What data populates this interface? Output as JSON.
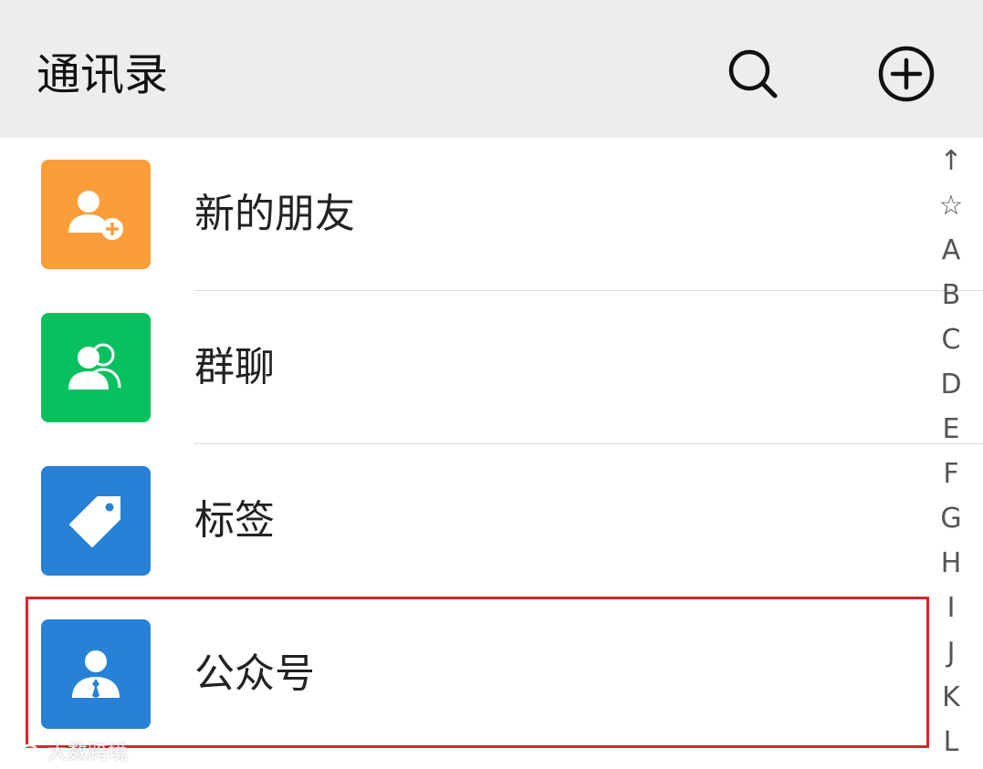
{
  "header": {
    "title": "通讯录",
    "search_icon": "search-icon",
    "add_icon": "plus-circle-icon",
    "background": "#ededed"
  },
  "list": {
    "items": [
      {
        "label": "新的朋友",
        "icon": "add-friend-icon",
        "color": "#fa9d3b"
      },
      {
        "label": "群聊",
        "icon": "group-chat-icon",
        "color": "#07c160"
      },
      {
        "label": "标签",
        "icon": "tag-icon",
        "color": "#2782d7"
      },
      {
        "label": "公众号",
        "icon": "official-account-icon",
        "color": "#2782d7"
      }
    ]
  },
  "highlight": {
    "color": "#d9232b"
  },
  "index_bar": {
    "letters": [
      "↑",
      "☆",
      "A",
      "B",
      "C",
      "D",
      "E",
      "F",
      "G",
      "H",
      "I",
      "J",
      "K",
      "L"
    ]
  },
  "watermark": {
    "text": "大数跨境"
  }
}
